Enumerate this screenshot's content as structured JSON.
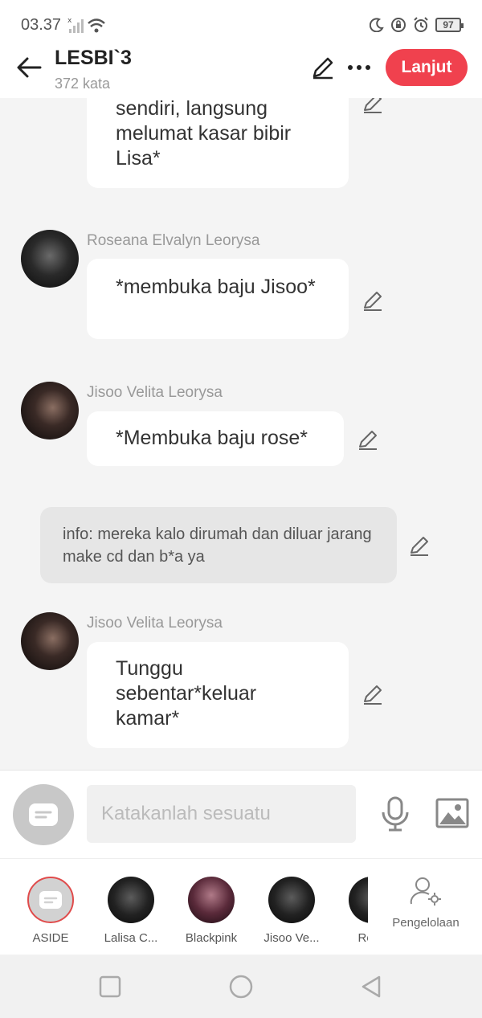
{
  "status_bar": {
    "time": "03.37",
    "battery": "97"
  },
  "header": {
    "title": "LESBI`3",
    "subtitle": "372 kata",
    "next_label": "Lanjut"
  },
  "messages": [
    {
      "type": "continued",
      "text": "sendiri, langsung melumat kasar bibir Lisa*"
    },
    {
      "type": "character",
      "name": "Roseana Elvalyn Leorysa",
      "text": "*membuka baju Jisoo*"
    },
    {
      "type": "character",
      "name": "Jisoo Velita Leorysa",
      "text": "*Membuka baju rose*"
    },
    {
      "type": "aside",
      "text": "info: mereka kalo dirumah dan diluar jarang make cd dan b*a ya"
    },
    {
      "type": "character",
      "name": "Jisoo Velita Leorysa",
      "text": "Tunggu sebentar*keluar kamar*"
    }
  ],
  "composer": {
    "placeholder": "Katakanlah sesuatu"
  },
  "characters": [
    {
      "label": "ASIDE"
    },
    {
      "label": "Lalisa C..."
    },
    {
      "label": "Blackpink"
    },
    {
      "label": "Jisoo Ve..."
    },
    {
      "label": "Rose"
    }
  ],
  "manage_label": "Pengelolaan",
  "colors": {
    "accent": "#f0414e",
    "bubble": "#ffffff",
    "aside_bubble": "#e6e6e6",
    "background": "#f4f4f4"
  }
}
